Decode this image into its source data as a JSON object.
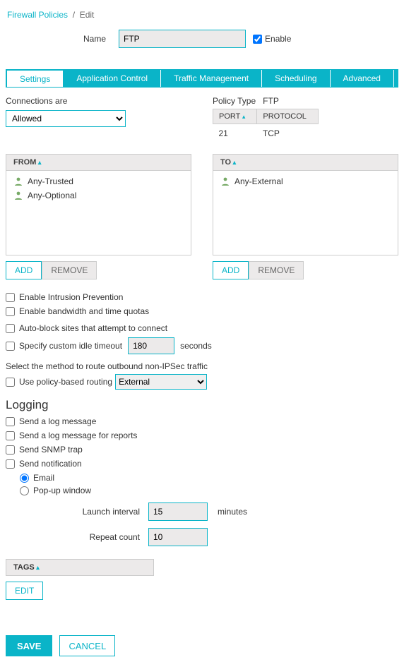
{
  "breadcrumb": {
    "parent": "Firewall Policies",
    "current": "Edit"
  },
  "name": {
    "label": "Name",
    "value": "FTP"
  },
  "enable": {
    "label": "Enable",
    "checked": true
  },
  "tabs": [
    "Settings",
    "Application Control",
    "Traffic Management",
    "Scheduling",
    "Advanced"
  ],
  "active_tab": 0,
  "connections": {
    "label": "Connections are",
    "value": "Allowed"
  },
  "policy_type": {
    "label": "Policy Type",
    "value": "FTP"
  },
  "port_table": {
    "cols": [
      "PORT",
      "PROTOCOL"
    ],
    "rows": [
      [
        "21",
        "TCP"
      ]
    ]
  },
  "from": {
    "header": "FROM",
    "members": [
      "Any-Trusted",
      "Any-Optional"
    ]
  },
  "to": {
    "header": "TO",
    "members": [
      "Any-External"
    ]
  },
  "buttons": {
    "add": "ADD",
    "remove": "REMOVE",
    "edit": "EDIT",
    "save": "SAVE",
    "cancel": "CANCEL"
  },
  "opts": {
    "ips": "Enable Intrusion Prevention",
    "quotas": "Enable bandwidth and time quotas",
    "autoblock": "Auto-block sites that attempt to connect",
    "idle_timeout_label": "Specify custom idle timeout",
    "idle_timeout_value": "180",
    "idle_timeout_unit": "seconds"
  },
  "routing": {
    "note": "Select the method to route outbound non-IPSec traffic",
    "label": "Use policy-based routing",
    "value": "External"
  },
  "logging": {
    "heading": "Logging",
    "items": [
      "Send a log message",
      "Send a log message for reports",
      "Send SNMP trap",
      "Send notification"
    ],
    "notify": {
      "email": "Email",
      "popup": "Pop-up window"
    },
    "launch_label": "Launch interval",
    "launch_value": "15",
    "launch_unit": "minutes",
    "repeat_label": "Repeat count",
    "repeat_value": "10"
  },
  "tags": {
    "header": "TAGS"
  }
}
